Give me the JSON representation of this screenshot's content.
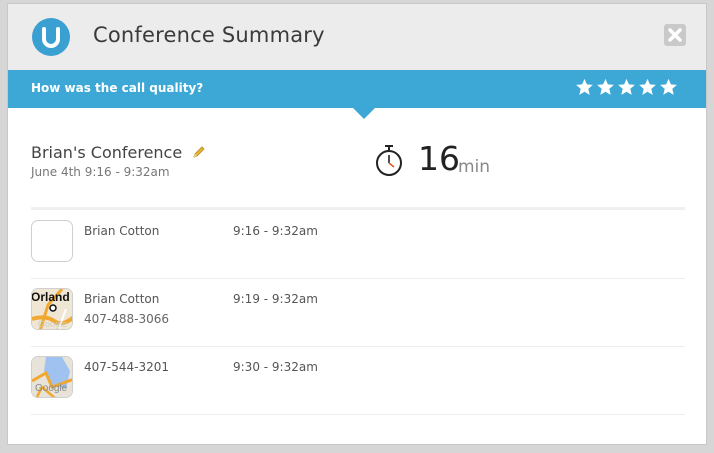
{
  "dialog": {
    "title": "Conference Summary",
    "logo_icon": "u-logo-icon",
    "close_icon": "close-icon"
  },
  "rating": {
    "prompt": "How was the call quality?",
    "stars_total": 5,
    "star_icon": "star-icon",
    "star_color": "#ffffff"
  },
  "conference": {
    "name": "Brian's Conference",
    "date": "June 4th 9:16 - 9:32am",
    "duration_value": "16",
    "duration_unit": "min",
    "timer_icon": "stopwatch-icon",
    "edit_icon": "pencil-icon"
  },
  "participants": [
    {
      "name": "Brian Cotton",
      "phone": "",
      "time": "9:16 - 9:32am",
      "thumb": "blank"
    },
    {
      "name": "Brian Cotton",
      "phone": "407-488-3066",
      "time": "9:19 - 9:32am",
      "thumb": "map-orlando"
    },
    {
      "name": "407-544-3201",
      "phone": "",
      "time": "9:30 - 9:32am",
      "thumb": "map-google"
    }
  ],
  "map_thumb_text": {
    "orlando": "Orland",
    "google": "Google"
  },
  "colors": {
    "accent": "#3da8d6",
    "logo": "#3a9fd1",
    "title_bg": "#ececec"
  }
}
